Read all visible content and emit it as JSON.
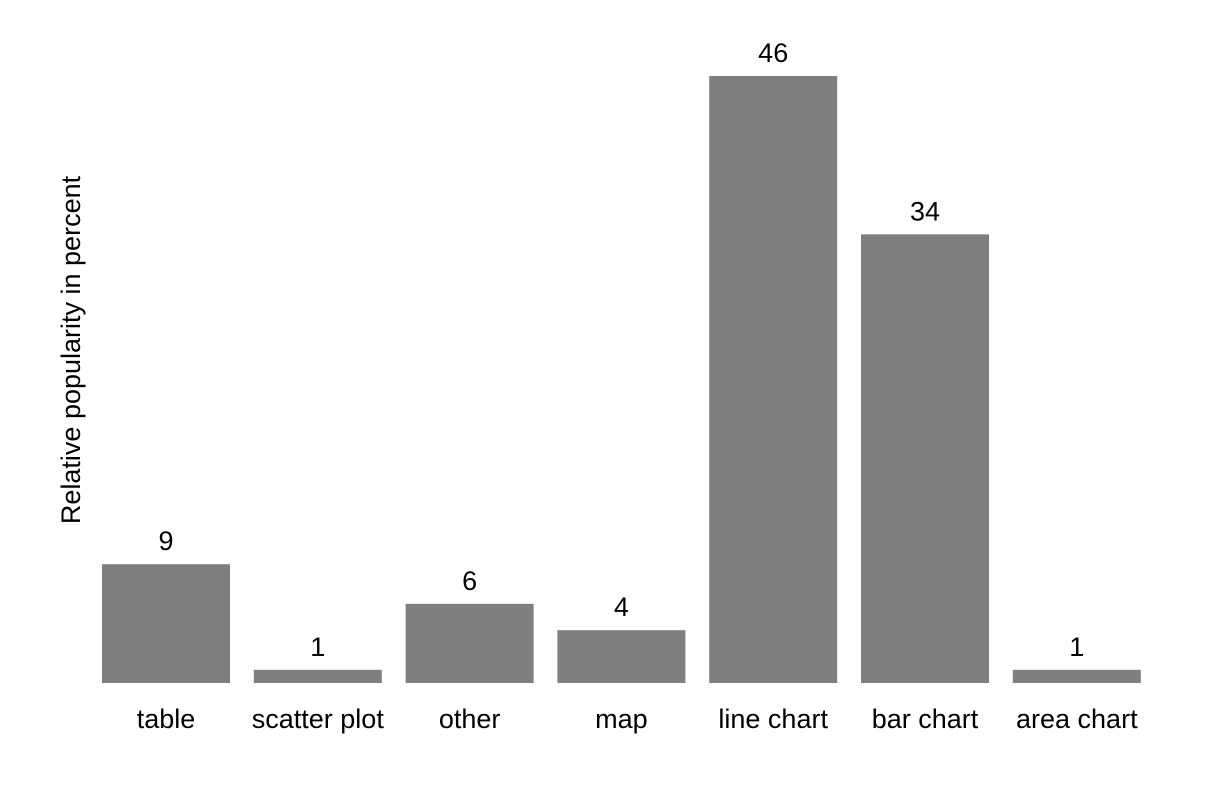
{
  "chart_data": {
    "type": "bar",
    "title": "",
    "xlabel": "",
    "ylabel": "Relative popularity  in percent",
    "categories": [
      "table",
      "scatter plot",
      "other",
      "map",
      "line chart",
      "bar chart",
      "area chart"
    ],
    "values": [
      9,
      1,
      6,
      4,
      46,
      34,
      1
    ],
    "data_labels": [
      "9",
      "1",
      "6",
      "4",
      "46",
      "34",
      "1"
    ],
    "ylim": [
      0,
      46
    ],
    "grid": false,
    "legend": "none",
    "bar_color": "#7f7f7f"
  }
}
